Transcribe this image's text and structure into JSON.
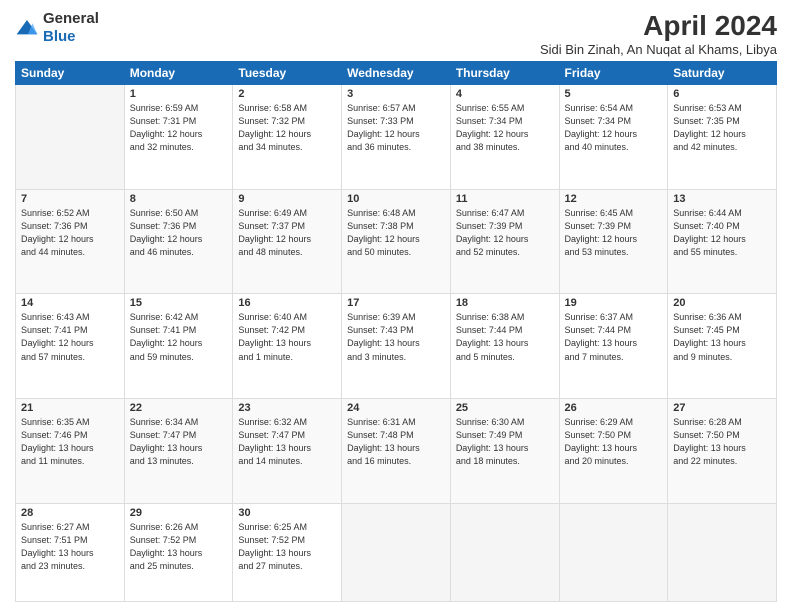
{
  "header": {
    "logo_general": "General",
    "logo_blue": "Blue",
    "month": "April 2024",
    "location": "Sidi Bin Zinah, An Nuqat al Khams, Libya"
  },
  "days_of_week": [
    "Sunday",
    "Monday",
    "Tuesday",
    "Wednesday",
    "Thursday",
    "Friday",
    "Saturday"
  ],
  "weeks": [
    [
      {
        "day": "",
        "info": ""
      },
      {
        "day": "1",
        "info": "Sunrise: 6:59 AM\nSunset: 7:31 PM\nDaylight: 12 hours\nand 32 minutes."
      },
      {
        "day": "2",
        "info": "Sunrise: 6:58 AM\nSunset: 7:32 PM\nDaylight: 12 hours\nand 34 minutes."
      },
      {
        "day": "3",
        "info": "Sunrise: 6:57 AM\nSunset: 7:33 PM\nDaylight: 12 hours\nand 36 minutes."
      },
      {
        "day": "4",
        "info": "Sunrise: 6:55 AM\nSunset: 7:34 PM\nDaylight: 12 hours\nand 38 minutes."
      },
      {
        "day": "5",
        "info": "Sunrise: 6:54 AM\nSunset: 7:34 PM\nDaylight: 12 hours\nand 40 minutes."
      },
      {
        "day": "6",
        "info": "Sunrise: 6:53 AM\nSunset: 7:35 PM\nDaylight: 12 hours\nand 42 minutes."
      }
    ],
    [
      {
        "day": "7",
        "info": "Sunrise: 6:52 AM\nSunset: 7:36 PM\nDaylight: 12 hours\nand 44 minutes."
      },
      {
        "day": "8",
        "info": "Sunrise: 6:50 AM\nSunset: 7:36 PM\nDaylight: 12 hours\nand 46 minutes."
      },
      {
        "day": "9",
        "info": "Sunrise: 6:49 AM\nSunset: 7:37 PM\nDaylight: 12 hours\nand 48 minutes."
      },
      {
        "day": "10",
        "info": "Sunrise: 6:48 AM\nSunset: 7:38 PM\nDaylight: 12 hours\nand 50 minutes."
      },
      {
        "day": "11",
        "info": "Sunrise: 6:47 AM\nSunset: 7:39 PM\nDaylight: 12 hours\nand 52 minutes."
      },
      {
        "day": "12",
        "info": "Sunrise: 6:45 AM\nSunset: 7:39 PM\nDaylight: 12 hours\nand 53 minutes."
      },
      {
        "day": "13",
        "info": "Sunrise: 6:44 AM\nSunset: 7:40 PM\nDaylight: 12 hours\nand 55 minutes."
      }
    ],
    [
      {
        "day": "14",
        "info": "Sunrise: 6:43 AM\nSunset: 7:41 PM\nDaylight: 12 hours\nand 57 minutes."
      },
      {
        "day": "15",
        "info": "Sunrise: 6:42 AM\nSunset: 7:41 PM\nDaylight: 12 hours\nand 59 minutes."
      },
      {
        "day": "16",
        "info": "Sunrise: 6:40 AM\nSunset: 7:42 PM\nDaylight: 13 hours\nand 1 minute."
      },
      {
        "day": "17",
        "info": "Sunrise: 6:39 AM\nSunset: 7:43 PM\nDaylight: 13 hours\nand 3 minutes."
      },
      {
        "day": "18",
        "info": "Sunrise: 6:38 AM\nSunset: 7:44 PM\nDaylight: 13 hours\nand 5 minutes."
      },
      {
        "day": "19",
        "info": "Sunrise: 6:37 AM\nSunset: 7:44 PM\nDaylight: 13 hours\nand 7 minutes."
      },
      {
        "day": "20",
        "info": "Sunrise: 6:36 AM\nSunset: 7:45 PM\nDaylight: 13 hours\nand 9 minutes."
      }
    ],
    [
      {
        "day": "21",
        "info": "Sunrise: 6:35 AM\nSunset: 7:46 PM\nDaylight: 13 hours\nand 11 minutes."
      },
      {
        "day": "22",
        "info": "Sunrise: 6:34 AM\nSunset: 7:47 PM\nDaylight: 13 hours\nand 13 minutes."
      },
      {
        "day": "23",
        "info": "Sunrise: 6:32 AM\nSunset: 7:47 PM\nDaylight: 13 hours\nand 14 minutes."
      },
      {
        "day": "24",
        "info": "Sunrise: 6:31 AM\nSunset: 7:48 PM\nDaylight: 13 hours\nand 16 minutes."
      },
      {
        "day": "25",
        "info": "Sunrise: 6:30 AM\nSunset: 7:49 PM\nDaylight: 13 hours\nand 18 minutes."
      },
      {
        "day": "26",
        "info": "Sunrise: 6:29 AM\nSunset: 7:50 PM\nDaylight: 13 hours\nand 20 minutes."
      },
      {
        "day": "27",
        "info": "Sunrise: 6:28 AM\nSunset: 7:50 PM\nDaylight: 13 hours\nand 22 minutes."
      }
    ],
    [
      {
        "day": "28",
        "info": "Sunrise: 6:27 AM\nSunset: 7:51 PM\nDaylight: 13 hours\nand 23 minutes."
      },
      {
        "day": "29",
        "info": "Sunrise: 6:26 AM\nSunset: 7:52 PM\nDaylight: 13 hours\nand 25 minutes."
      },
      {
        "day": "30",
        "info": "Sunrise: 6:25 AM\nSunset: 7:52 PM\nDaylight: 13 hours\nand 27 minutes."
      },
      {
        "day": "",
        "info": ""
      },
      {
        "day": "",
        "info": ""
      },
      {
        "day": "",
        "info": ""
      },
      {
        "day": "",
        "info": ""
      }
    ]
  ]
}
